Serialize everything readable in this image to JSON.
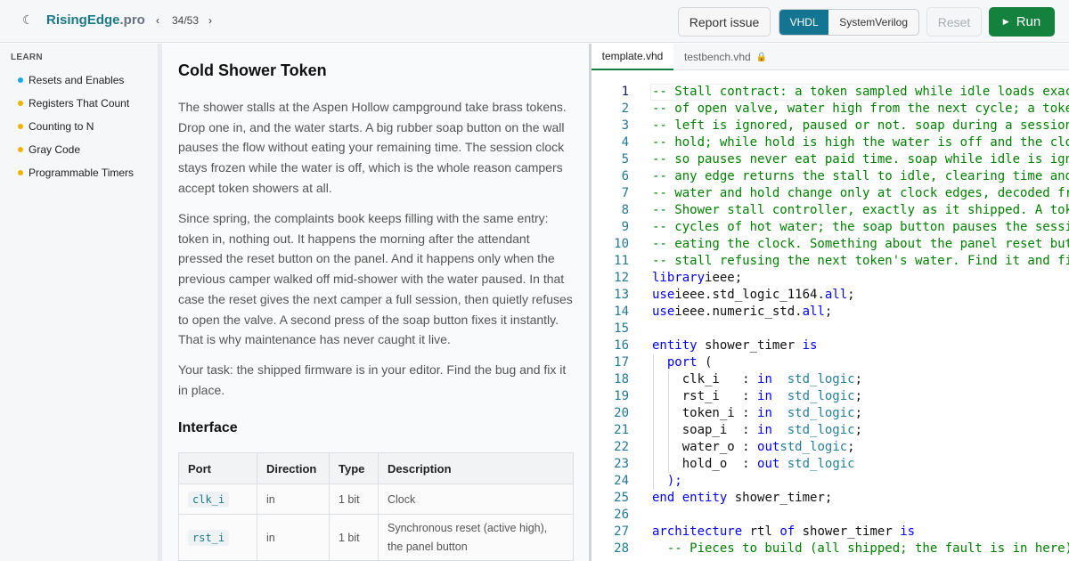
{
  "header": {
    "theme_icon": "moon-icon",
    "logo_brand": "RisingEdge",
    "logo_tld": ".pro",
    "nav_prev": "‹",
    "nav_count": "34/53",
    "nav_next": "›",
    "report_label": "Report issue",
    "lang_vhdl": "VHDL",
    "lang_sv": "SystemVerilog",
    "reset_label": "Reset",
    "run_label": "Run",
    "run_icon": "▶"
  },
  "sidebar": {
    "heading": "LEARN",
    "items": [
      {
        "label": "Resets and Enables",
        "dot_color": "#1ea7e8"
      },
      {
        "label": "Registers That Count",
        "dot_color": "#f0b400"
      },
      {
        "label": "Counting to N",
        "dot_color": "#f0b400"
      },
      {
        "label": "Gray Code",
        "dot_color": "#f0b400"
      },
      {
        "label": "Programmable Timers",
        "dot_color": "#f0b400"
      }
    ]
  },
  "problem": {
    "title": "Cold Shower Token",
    "paragraphs": [
      "The shower stalls at the Aspen Hollow campground take brass tokens. Drop one in, and the water starts. A big rubber soap button on the wall pauses the flow without eating your remaining time. The session clock stays frozen while the water is off, which is the whole reason campers accept token showers at all.",
      "Since spring, the complaints book keeps filling with the same entry: token in, nothing out. It happens the morning after the attendant pressed the reset button on the panel. And it happens only when the previous camper walked off mid-shower with the water paused. In that case the reset gives the next camper a full session, then quietly refuses to open the valve. A second press of the soap button fixes it instantly. That is why maintenance has never caught it live.",
      "Your task: the shipped firmware is in your editor. Find the bug and fix it in place."
    ],
    "interface_heading": "Interface",
    "table": {
      "headers": [
        "Port",
        "Direction",
        "Type",
        "Description"
      ],
      "rows": [
        {
          "port": "clk_i",
          "direction": "in",
          "type": "1 bit",
          "description": "Clock"
        },
        {
          "port": "rst_i",
          "direction": "in",
          "type": "1 bit",
          "description": "Synchronous reset (active high), the panel button"
        }
      ]
    }
  },
  "editor": {
    "tabs": [
      {
        "label": "template.vhd",
        "active": true
      },
      {
        "label": "testbench.vhd",
        "locked": true,
        "icon": "lock-icon"
      }
    ],
    "current_line": 1,
    "lines": [
      [
        [
          "cm",
          "-- Stall contract: a token sampled while idle loads exactly"
        ]
      ],
      [
        [
          "cm",
          "-- of open valve, water high from the next cycle; a token"
        ]
      ],
      [
        [
          "cm",
          "-- left is ignored, paused or not. soap during a session"
        ]
      ],
      [
        [
          "cm",
          "-- hold; while hold is high the water is off and the clock"
        ]
      ],
      [
        [
          "cm",
          "-- so pauses never eat paid time. soap while idle is ignored"
        ]
      ],
      [
        [
          "cm",
          "-- any edge returns the stall to idle, clearing time and"
        ]
      ],
      [
        [
          "cm",
          "-- water and hold change only at clock edges, decoded from"
        ]
      ],
      [
        [
          "cm",
          "-- Shower stall controller, exactly as it shipped. A token"
        ]
      ],
      [
        [
          "cm",
          "-- cycles of hot water; the soap button pauses the session"
        ]
      ],
      [
        [
          "cm",
          "-- eating the clock. Something about the panel reset button"
        ]
      ],
      [
        [
          "cm",
          "-- stall refusing the next token's water. Find it and fix"
        ]
      ],
      [
        [
          "kw",
          "library"
        ],
        [
          "",
          "ieee;"
        ]
      ],
      [
        [
          "kw",
          "use"
        ],
        [
          "",
          "ieee.std_logic_1164."
        ],
        [
          "kw",
          "all"
        ],
        [
          "",
          ";"
        ]
      ],
      [
        [
          "kw",
          "use"
        ],
        [
          "",
          "ieee.numeric_std."
        ],
        [
          "kw",
          "all"
        ],
        [
          "",
          ";"
        ]
      ],
      [],
      [
        [
          "kw",
          "entity"
        ],
        [
          "",
          " shower_timer "
        ],
        [
          "kw",
          "is"
        ]
      ],
      [
        [
          "",
          "  "
        ],
        [
          "kw",
          "port"
        ],
        [
          "",
          " ("
        ]
      ],
      [
        [
          "",
          "    clk_i   : "
        ],
        [
          "kw",
          "in"
        ],
        [
          "",
          "  "
        ],
        [
          "ty",
          "std_logic"
        ],
        [
          "",
          ";"
        ]
      ],
      [
        [
          "",
          "    rst_i   : "
        ],
        [
          "kw",
          "in"
        ],
        [
          "",
          "  "
        ],
        [
          "ty",
          "std_logic"
        ],
        [
          "",
          ";"
        ]
      ],
      [
        [
          "",
          "    token_i : "
        ],
        [
          "kw",
          "in"
        ],
        [
          "",
          "  "
        ],
        [
          "ty",
          "std_logic"
        ],
        [
          "",
          ";"
        ]
      ],
      [
        [
          "",
          "    soap_i  : "
        ],
        [
          "kw",
          "in"
        ],
        [
          "",
          "  "
        ],
        [
          "ty",
          "std_logic"
        ],
        [
          "",
          ";"
        ]
      ],
      [
        [
          "",
          "    water_o : "
        ],
        [
          "kw",
          "out"
        ],
        [
          "",
          "",
          " "
        ],
        [
          "ty",
          "std_logic"
        ],
        [
          "",
          ";"
        ]
      ],
      [
        [
          "",
          "    hold_o  : "
        ],
        [
          "kw",
          "out"
        ],
        [
          "",
          " "
        ],
        [
          "ty",
          "std_logic"
        ]
      ],
      [
        [
          "",
          "  "
        ],
        [
          "kw",
          ");"
        ]
      ],
      [
        [
          "kw",
          "end"
        ],
        [
          "",
          " "
        ],
        [
          "kw",
          "entity"
        ],
        [
          "",
          " shower_timer;"
        ]
      ],
      [],
      [
        [
          "kw",
          "architecture"
        ],
        [
          "",
          " rtl "
        ],
        [
          "kw",
          "of"
        ],
        [
          "",
          " shower_timer "
        ],
        [
          "kw",
          "is"
        ]
      ],
      [
        [
          "cm",
          "  -- Pieces to build (all shipped; the fault is in here)"
        ]
      ]
    ]
  }
}
